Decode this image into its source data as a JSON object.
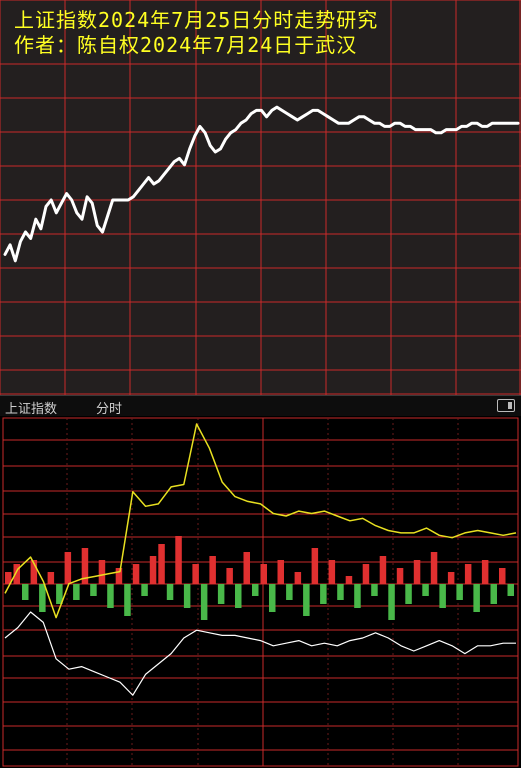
{
  "title": {
    "line1": "上证指数2024年7月25日分时走势研究",
    "line2": "作者：陈自权2024年7月24日于武汉"
  },
  "toolbar": {
    "index_name": "上证指数",
    "mode": "分时",
    "toggle_icon": "panel-toggle-icon"
  },
  "colors": {
    "top_bg": "#231f1f",
    "grid": "#c92a2a",
    "top_line": "#ffffff",
    "title": "#ffff22",
    "bottom_bg": "#000000",
    "yellow_line": "#e8e020",
    "white_line": "#ffffff",
    "up_bar": "#e03030",
    "down_bar": "#49b849"
  },
  "chart_data": [
    {
      "type": "line",
      "description_scope": "top panel forecast curve (no axis labels printed)",
      "x_range": [
        0,
        100
      ],
      "ylim": [
        0,
        100
      ],
      "grid": true,
      "series": [
        {
          "x": [
            0,
            1,
            2,
            3,
            4,
            5,
            6,
            7,
            8,
            9,
            10,
            11,
            12,
            13,
            14,
            15,
            16,
            17,
            18,
            19,
            20,
            21,
            22,
            23,
            24,
            25,
            26,
            27,
            28,
            29,
            30,
            31,
            32,
            33,
            34,
            35,
            36,
            37,
            38,
            39,
            40,
            41,
            42,
            43,
            44,
            45,
            46,
            47,
            48,
            49,
            50,
            51,
            52,
            53,
            54,
            55,
            56,
            57,
            58,
            59,
            60,
            61,
            62,
            63,
            64,
            65,
            66,
            67,
            68,
            69,
            70,
            71,
            72,
            73,
            74,
            75,
            76,
            77,
            78,
            79,
            80,
            81,
            82,
            83,
            84,
            85,
            86,
            87,
            88,
            89,
            90,
            91,
            92,
            93,
            94,
            95,
            96,
            97,
            98,
            99,
            100
          ],
          "y": [
            33,
            36,
            31,
            37,
            40,
            38,
            44,
            41,
            48,
            50,
            46,
            49,
            52,
            50,
            46,
            44,
            51,
            49,
            42,
            40,
            45,
            50,
            50,
            50,
            50,
            51,
            53,
            55,
            57,
            55,
            56,
            58,
            60,
            62,
            63,
            61,
            66,
            70,
            73,
            71,
            67,
            65,
            66,
            69,
            71,
            72,
            74,
            75,
            77,
            78,
            78,
            76,
            78,
            79,
            78,
            77,
            76,
            75,
            76,
            77,
            78,
            78,
            77,
            76,
            75,
            74,
            74,
            74,
            75,
            76,
            76,
            75,
            74,
            74,
            73,
            73,
            74,
            74,
            73,
            73,
            72,
            72,
            72,
            72,
            71,
            71,
            72,
            72,
            72,
            73,
            73,
            74,
            74,
            73,
            73,
            74,
            74,
            74,
            74,
            74,
            74
          ]
        }
      ]
    },
    {
      "type": "line",
      "description_scope": "bottom panel intraday price curve (yellow) with volume bars and indicator line",
      "x_range": [
        0,
        240
      ],
      "ylim": [
        0,
        100
      ],
      "grid": true,
      "series": [
        {
          "x": [
            0,
            6,
            12,
            18,
            24,
            30,
            36,
            42,
            48,
            54,
            60,
            66,
            72,
            78,
            84,
            90,
            96,
            102,
            108,
            114,
            120,
            126,
            132,
            138,
            144,
            150,
            156,
            162,
            168,
            174,
            180,
            186,
            192,
            198,
            204,
            210,
            216,
            222,
            228,
            234,
            240
          ],
          "y": [
            30,
            40,
            45,
            35,
            20,
            34,
            36,
            37,
            38,
            39,
            72,
            66,
            67,
            74,
            75,
            100,
            90,
            76,
            70,
            68,
            67,
            63,
            62,
            64,
            63,
            64,
            62,
            60,
            61,
            58,
            56,
            55,
            55,
            57,
            54,
            53,
            55,
            56,
            55,
            54,
            55
          ]
        },
        {
          "x": [
            0,
            6,
            12,
            18,
            24,
            30,
            36,
            42,
            48,
            54,
            60,
            66,
            72,
            78,
            84,
            90,
            96,
            102,
            108,
            114,
            120,
            126,
            132,
            138,
            144,
            150,
            156,
            162,
            168,
            174,
            180,
            186,
            192,
            198,
            204,
            210,
            216,
            222,
            228,
            234,
            240
          ],
          "y": [
            30,
            34,
            40,
            36,
            22,
            18,
            19,
            17,
            15,
            13,
            8,
            16,
            20,
            24,
            30,
            33,
            32,
            31,
            31,
            30,
            29,
            27,
            28,
            29,
            27,
            28,
            27,
            29,
            30,
            32,
            30,
            27,
            25,
            27,
            29,
            27,
            24,
            27,
            27,
            28,
            28
          ]
        }
      ],
      "volume_bars": [
        3,
        5,
        -4,
        6,
        -7,
        3,
        -5,
        8,
        -4,
        9,
        -3,
        6,
        -6,
        4,
        -8,
        5,
        -3,
        7,
        10,
        -4,
        12,
        -6,
        5,
        -9,
        7,
        -5,
        4,
        -6,
        8,
        -3,
        5,
        -7,
        6,
        -4,
        3,
        -8,
        9,
        -5,
        6,
        -4,
        2,
        -6,
        5,
        -3,
        7,
        -9,
        4,
        -5,
        6,
        -3,
        8,
        -6,
        3,
        -4,
        5,
        -7,
        6,
        -5,
        4,
        -3
      ]
    }
  ]
}
